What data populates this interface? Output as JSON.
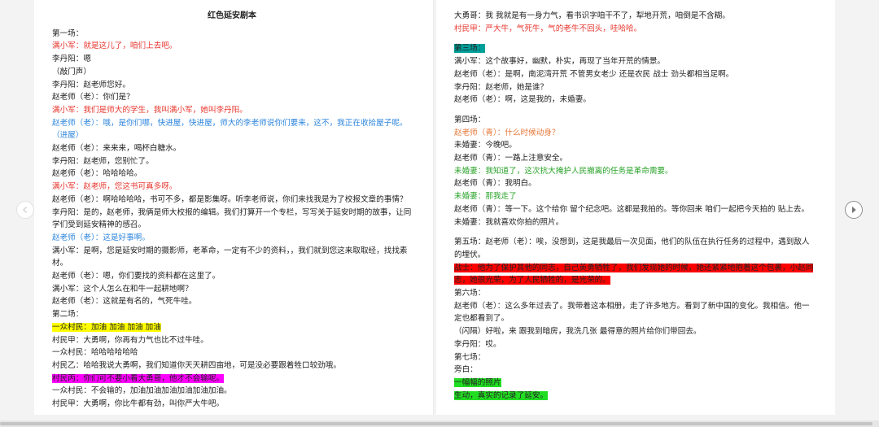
{
  "document": {
    "title": "红色延安剧本",
    "left_lines": [
      {
        "text": "第一场：",
        "color": "",
        "highlight": ""
      },
      {
        "text": "满小军：就是这儿了，咱们上去吧。",
        "color": "c-red",
        "highlight": ""
      },
      {
        "text": "李丹阳：嗯",
        "color": "",
        "highlight": ""
      },
      {
        "text": "（敲门声）",
        "color": "",
        "highlight": ""
      },
      {
        "text": "李丹阳：赵老师您好。",
        "color": "",
        "highlight": ""
      },
      {
        "text": "赵老师（老）：你们是？",
        "color": "",
        "highlight": ""
      },
      {
        "text": "满小军：我们是师大的学生，我叫满小军，她叫李丹阳。",
        "color": "c-red",
        "highlight": ""
      },
      {
        "text": "赵老师（老）：哦，是你们哪，快进屋，快进屋，师大的李老师说你们要来，这不，我正在收拾屋子呢。（进屋）",
        "color": "c-blue",
        "highlight": "",
        "wrap": true
      },
      {
        "text": "赵老师（老）：来来来，喝杯白糖水。",
        "color": "",
        "highlight": ""
      },
      {
        "text": "李丹阳：赵老师，您别忙了。",
        "color": "",
        "highlight": ""
      },
      {
        "text": "赵老师（老）：哈哈哈哈。",
        "color": "",
        "highlight": ""
      },
      {
        "text": "满小军：赵老师，您这书可真多呀。",
        "color": "c-red",
        "highlight": ""
      },
      {
        "text": "赵老师（老）：啊哈哈哈哈，书可不多，都是影集呀。听李老师说，你们来找我是为了校报文章的事情？",
        "color": "",
        "highlight": "",
        "wrap": true
      },
      {
        "text": "李丹阳：是的，赵老师，我俩是师大校报的编辑。我们打算开一个专栏，写写关于延安时期的故事，让同学们受到延安精神的感召。",
        "color": "",
        "highlight": "",
        "wrap": true
      },
      {
        "text": "赵老师（老）：这是好事啊。",
        "color": "c-blue",
        "highlight": ""
      },
      {
        "text": "满小军：是啊，您是延安时期的摄影师，老革命，一定有不少的资料，，我们就到您这来取取经，找找素材。",
        "color": "",
        "highlight": "",
        "wrap": true
      },
      {
        "text": "赵老师（老）：嗯，你们要找的资料都在这里了。",
        "color": "",
        "highlight": ""
      },
      {
        "text": "满小军：这个人怎么在和牛一起耕地啊？",
        "color": "",
        "highlight": ""
      },
      {
        "text": "赵老师（老）：这就是有名的，气死牛哇。",
        "color": "",
        "highlight": ""
      },
      {
        "text": "第二场：",
        "color": "",
        "highlight": ""
      },
      {
        "text": "一众村民：加油  加油  加油  加油",
        "color": "",
        "highlight": "hl-yellow"
      },
      {
        "text": "村民甲：大勇啊，你再有力气也比不过牛哇。",
        "color": "",
        "highlight": ""
      },
      {
        "text": "一众村民：哈哈哈哈哈哈",
        "color": "",
        "highlight": ""
      },
      {
        "text": "村民乙：哈哈我说大勇啊，我们知道你天天耕四亩地，可是没必要跟着牲口较劲哦。",
        "color": "",
        "highlight": ""
      },
      {
        "text": "村民丙：你们可不要小看大勇哥，他才不会输呢。",
        "color": "",
        "highlight": "hl-magenta"
      },
      {
        "text": "一众村民：不会输的，加油加油加油加油加油加油。",
        "color": "",
        "highlight": ""
      },
      {
        "text": "村民甲：大勇啊，你比牛都有劲，叫你严大牛吧。",
        "color": "",
        "highlight": ""
      }
    ],
    "right_lines": [
      {
        "text": "大勇哥：我  我就是有一身力气，看书识字咱干不了，犁地开荒，咱倒是不含糊。",
        "color": "",
        "highlight": ""
      },
      {
        "text": "村民甲：严大牛，气死牛，气的老牛不回头，哇哈哈。",
        "color": "c-red",
        "highlight": ""
      },
      {
        "text": "",
        "color": "",
        "highlight": "",
        "gap": true
      },
      {
        "text": "第三场：",
        "color": "",
        "highlight": "hl-teal"
      },
      {
        "text": "满小军：这个故事好，幽默，朴实，再现了当年开荒的情景。",
        "color": "",
        "highlight": ""
      },
      {
        "text": "赵老师（老）：是啊，南泥湾开荒  不管男女老少  还是农民  战士  劲头都相当足啊。",
        "color": "",
        "highlight": ""
      },
      {
        "text": "李丹阳：赵老师，她是谁？",
        "color": "",
        "highlight": ""
      },
      {
        "text": "赵老师（老）：啊，这是我的，未婚妻。",
        "color": "",
        "highlight": ""
      },
      {
        "text": "",
        "color": "",
        "highlight": "",
        "gap": true
      },
      {
        "text": "第四场：",
        "color": "",
        "highlight": ""
      },
      {
        "text": "赵老师（青）：什么时候动身？",
        "color": "c-orange",
        "highlight": ""
      },
      {
        "text": "未婚妻：今晚吧。",
        "color": "",
        "highlight": ""
      },
      {
        "text": "赵老师（青）：一路上注意安全。",
        "color": "",
        "highlight": ""
      },
      {
        "text": "未婚妻：我知道了，这次抗大掩护人民撤离的任务是革命需要。",
        "color": "c-green",
        "highlight": ""
      },
      {
        "text": "赵老师（青）：我明白。",
        "color": "",
        "highlight": ""
      },
      {
        "text": "未婚妻：那我走了",
        "color": "c-green",
        "highlight": ""
      },
      {
        "text": "赵老师（青）：等一下。这个给你  留个纪念吧。这都是我拍的。等你回来  咱们一起把今天拍的  贴上去。",
        "color": "",
        "highlight": "",
        "wrap": true
      },
      {
        "text": "未婚妻：我就喜欢你拍的照片。",
        "color": "",
        "highlight": ""
      },
      {
        "text": "",
        "color": "",
        "highlight": "",
        "gap": true
      },
      {
        "text": "第五场：赵老师（老）：唉，没想到，这是我最后一次见面，他们的队伍在执行任务的过程中，遇到敌人的埋伏。",
        "color": "",
        "highlight": "",
        "wrap": true
      },
      {
        "text": "战士：他为了保护其他的同志，自己英勇牺牲了，我们发现她的时候，她还紧紧地抱着这个包裹，小赵同志，她很光荣，为了人民牺牲的，是光荣的。",
        "color": "",
        "highlight": "hl-red",
        "wrap": true
      },
      {
        "text": "第六场：",
        "color": "",
        "highlight": ""
      },
      {
        "text": "赵老师（老）：这么多年过去了。我带着这本相册，走了许多地方。看到了新中国的变化。我相信。他一定也都看到了。",
        "color": "",
        "highlight": "",
        "wrap": true
      },
      {
        "text": "（闪隔）好啦，来  跟我到暗房，我洗几张  最得意的照片给你们带回去。",
        "color": "",
        "highlight": ""
      },
      {
        "text": "李丹阳：哎。",
        "color": "",
        "highlight": ""
      },
      {
        "text": "第七场：",
        "color": "",
        "highlight": ""
      },
      {
        "text": "旁白：",
        "color": "",
        "highlight": ""
      },
      {
        "text": "一幅幅的照片",
        "color": "",
        "highlight": "hl-green"
      },
      {
        "text": "生动，真实的记录了延安。",
        "color": "",
        "highlight": "hl-green"
      }
    ]
  },
  "navigation": {
    "prev_icon": "chevron-left-icon",
    "next_icon": "chevron-right-icon"
  }
}
